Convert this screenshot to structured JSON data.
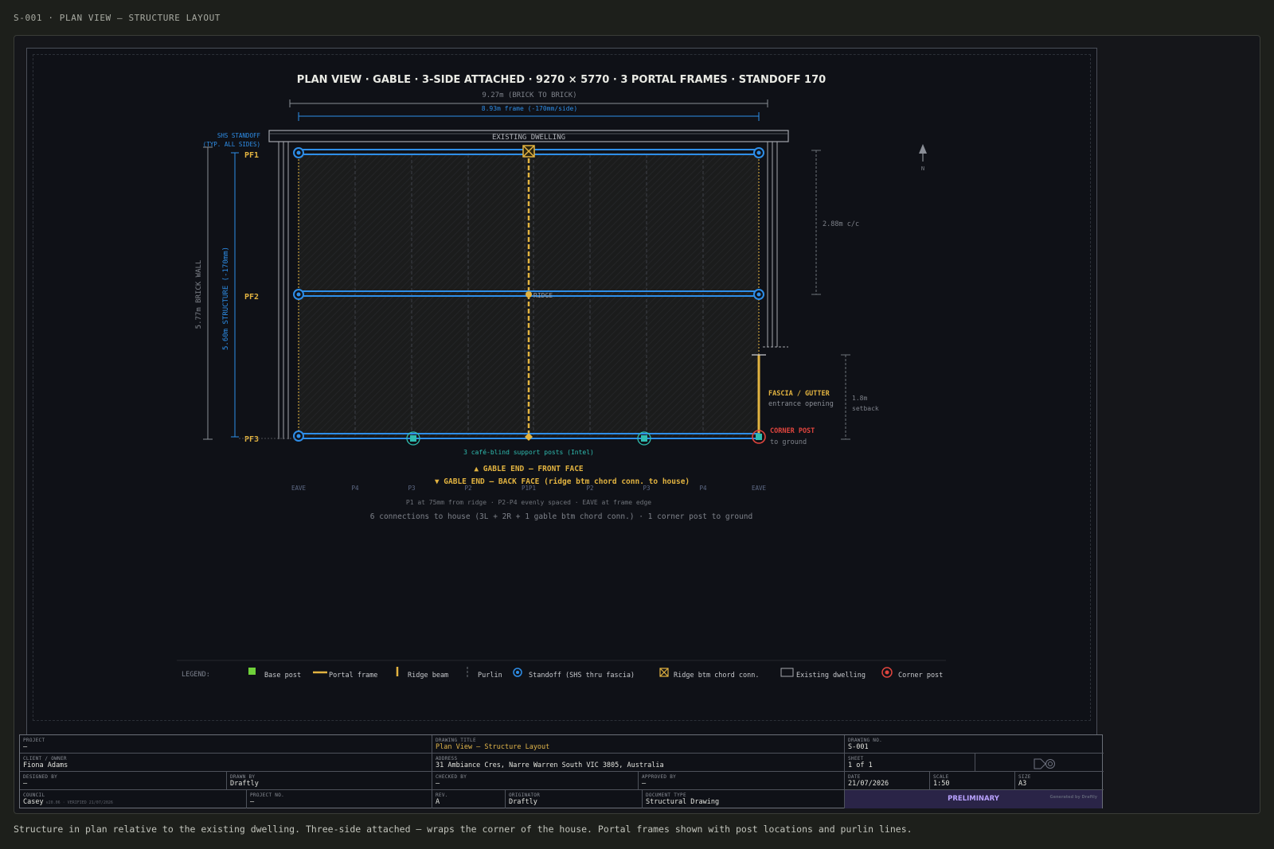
{
  "header": {
    "caption": "S-001 · PLAN VIEW — STRUCTURE LAYOUT"
  },
  "footer": {
    "caption": "Structure in plan relative to the existing dwelling. Three-side attached — wraps the corner of the house. Portal frames shown with post locations and purlin lines."
  },
  "drawing": {
    "title": "PLAN VIEW · GABLE · 3-SIDE ATTACHED · 9270 × 5770 · 3 PORTAL FRAMES · STANDOFF 170",
    "dim_brick": "9.27m (BRICK TO BRICK)",
    "dim_frame": "8.93m frame (-170mm/side)",
    "existing_dwelling": "EXISTING DWELLING",
    "standoff_note_1": "SHS STANDOFF",
    "standoff_note_2": "(TYP. ALL SIDES)",
    "frames": [
      "PF1",
      "PF2",
      "PF3"
    ],
    "ridge_label": "RIDGE",
    "dim_wall_vertical": "5.77m BRICK WALL",
    "dim_structure_vertical": "5.60m STRUCTURE (-170mm)",
    "dim_spacing": "2.88m c/c",
    "north": "N",
    "fascia_label": "FASCIA / GUTTER",
    "fascia_sub": "entrance opening",
    "setback_1": "1.8m",
    "setback_2": "setback",
    "corner_post_label": "CORNER POST",
    "corner_post_sub": "to ground",
    "cafe_posts": "3 café-blind support posts (Intel)",
    "gable_front": "▲ GABLE END — FRONT FACE",
    "gable_back": "▼ GABLE END — BACK FACE (ridge btm chord conn. to house)",
    "purlin_labels": [
      "EAVE",
      "P4",
      "P3",
      "P2",
      "P1P1",
      "P2",
      "P3",
      "P4",
      "EAVE"
    ],
    "note_1": "P1 at 75mm from ridge · P2-P4 evenly spaced · EAVE at frame edge",
    "note_2": "6 connections to house (3L + 2R + 1 gable btm chord conn.) · 1 corner post to ground"
  },
  "legend": {
    "title": "LEGEND:",
    "items": [
      {
        "label": "Base post",
        "icon": "base-post-icon"
      },
      {
        "label": "Portal frame",
        "icon": "portal-frame-icon"
      },
      {
        "label": "Ridge beam",
        "icon": "ridge-beam-icon"
      },
      {
        "label": "Purlin",
        "icon": "purlin-icon"
      },
      {
        "label": "Standoff (SHS thru fascia)",
        "icon": "standoff-icon"
      },
      {
        "label": "Ridge btm chord conn.",
        "icon": "ridge-connection-icon"
      },
      {
        "label": "Existing dwelling",
        "icon": "existing-dwelling-icon"
      },
      {
        "label": "Corner post",
        "icon": "corner-post-icon"
      }
    ]
  },
  "title_block": {
    "project": {
      "label": "PROJECT",
      "value": "—"
    },
    "drawing_title": {
      "label": "DRAWING TITLE",
      "value": "Plan View — Structure Layout"
    },
    "drawing_no": {
      "label": "DRAWING NO.",
      "value": "S-001"
    },
    "client": {
      "label": "CLIENT / OWNER",
      "value": "Fiona Adams"
    },
    "address": {
      "label": "ADDRESS",
      "value": "31 Ambiance Cres, Narre Warren South VIC 3805, Australia"
    },
    "sheet": {
      "label": "SHEET",
      "value": "1 of 1"
    },
    "designed_by": {
      "label": "DESIGNED BY",
      "value": "—"
    },
    "drawn_by": {
      "label": "DRAWN BY",
      "value": "Draftly"
    },
    "checked_by": {
      "label": "CHECKED BY",
      "value": "—"
    },
    "approved_by": {
      "label": "APPROVED BY",
      "value": "—"
    },
    "date": {
      "label": "DATE",
      "value": "21/07/2026"
    },
    "scale": {
      "label": "SCALE",
      "value": "1:50"
    },
    "size": {
      "label": "SIZE",
      "value": "A3"
    },
    "council": {
      "label": "COUNCIL",
      "value": "Casey",
      "note": "v20.06 · VERIFIED 21/07/2026"
    },
    "project_no": {
      "label": "PROJECT NO.",
      "value": "—"
    },
    "rev": {
      "label": "REV.",
      "value": "A"
    },
    "originator": {
      "label": "ORIGINATOR",
      "value": "Draftly"
    },
    "document_type": {
      "label": "DOCUMENT TYPE",
      "value": "Structural Drawing"
    },
    "status": "PRELIMINARY",
    "generated": "Generated by Draftly"
  },
  "colors": {
    "frame_blue": "#2e8ee8",
    "ridge_gold": "#e2b340",
    "corner_red": "#e0453e",
    "post_teal": "#2fbcb0",
    "base_green": "#6fd13a"
  }
}
